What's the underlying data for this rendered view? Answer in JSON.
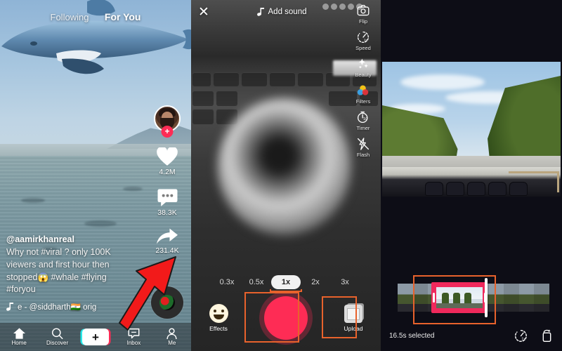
{
  "panel1": {
    "name": "tiktok-feed-screen",
    "tabs": [
      {
        "label": "Following",
        "active": false
      },
      {
        "label": "For You",
        "active": true
      }
    ],
    "actions": [
      {
        "icon": "heart-icon",
        "count": "4.2M"
      },
      {
        "icon": "comment-icon",
        "count": "38.3K"
      },
      {
        "icon": "share-icon",
        "count": "231.4K"
      }
    ],
    "follow_badge": "+",
    "caption": {
      "username": "@aamirkhanreal",
      "line1": "Why not #viral ? only 100K",
      "line2": "viewers and first hour then",
      "line3": "stopped😱 #whale #flying",
      "line4": "#foryou",
      "music": "e - @siddharth🇮🇳    orig"
    },
    "navbar": [
      {
        "label": "Home",
        "icon": "home-icon"
      },
      {
        "label": "Discover",
        "icon": "search-icon"
      },
      {
        "label": "",
        "icon": "plus-create-icon"
      },
      {
        "label": "Inbox",
        "icon": "inbox-icon"
      },
      {
        "label": "Me",
        "icon": "person-icon"
      }
    ],
    "create_button_label": "+"
  },
  "panel2": {
    "name": "tiktok-camera-screen",
    "close_label": "✕",
    "add_sound_label": "Add sound",
    "tools": [
      {
        "label": "Flip",
        "icon": "flip-camera-icon"
      },
      {
        "label": "Speed",
        "icon": "speed-icon"
      },
      {
        "label": "Beauty",
        "icon": "beauty-sparkle-icon"
      },
      {
        "label": "Filters",
        "icon": "filters-icon"
      },
      {
        "label": "Timer",
        "icon": "timer-icon"
      },
      {
        "label": "Flash",
        "icon": "flash-off-icon"
      }
    ],
    "zoom_levels": [
      {
        "label": "0.3x",
        "selected": false
      },
      {
        "label": "0.5x",
        "selected": false
      },
      {
        "label": "1x",
        "selected": true
      },
      {
        "label": "2x",
        "selected": false
      },
      {
        "label": "3x",
        "selected": false
      }
    ],
    "effects_label": "Effects",
    "upload_label": "Upload",
    "record_button": "record-button",
    "highlight_color": "#e8622c"
  },
  "panel3": {
    "name": "tiktok-trim-screen",
    "selected_duration_label": "16.5s selected",
    "bottom_icons": [
      {
        "icon": "speed-icon"
      },
      {
        "icon": "rotate-icon"
      }
    ],
    "trim_handles": 2,
    "highlight_color": "#e8622c",
    "selection_color": "#f0295c"
  },
  "annotation": {
    "arrow_color": "#f21a1a",
    "arrow_target": "create-plus-button"
  }
}
